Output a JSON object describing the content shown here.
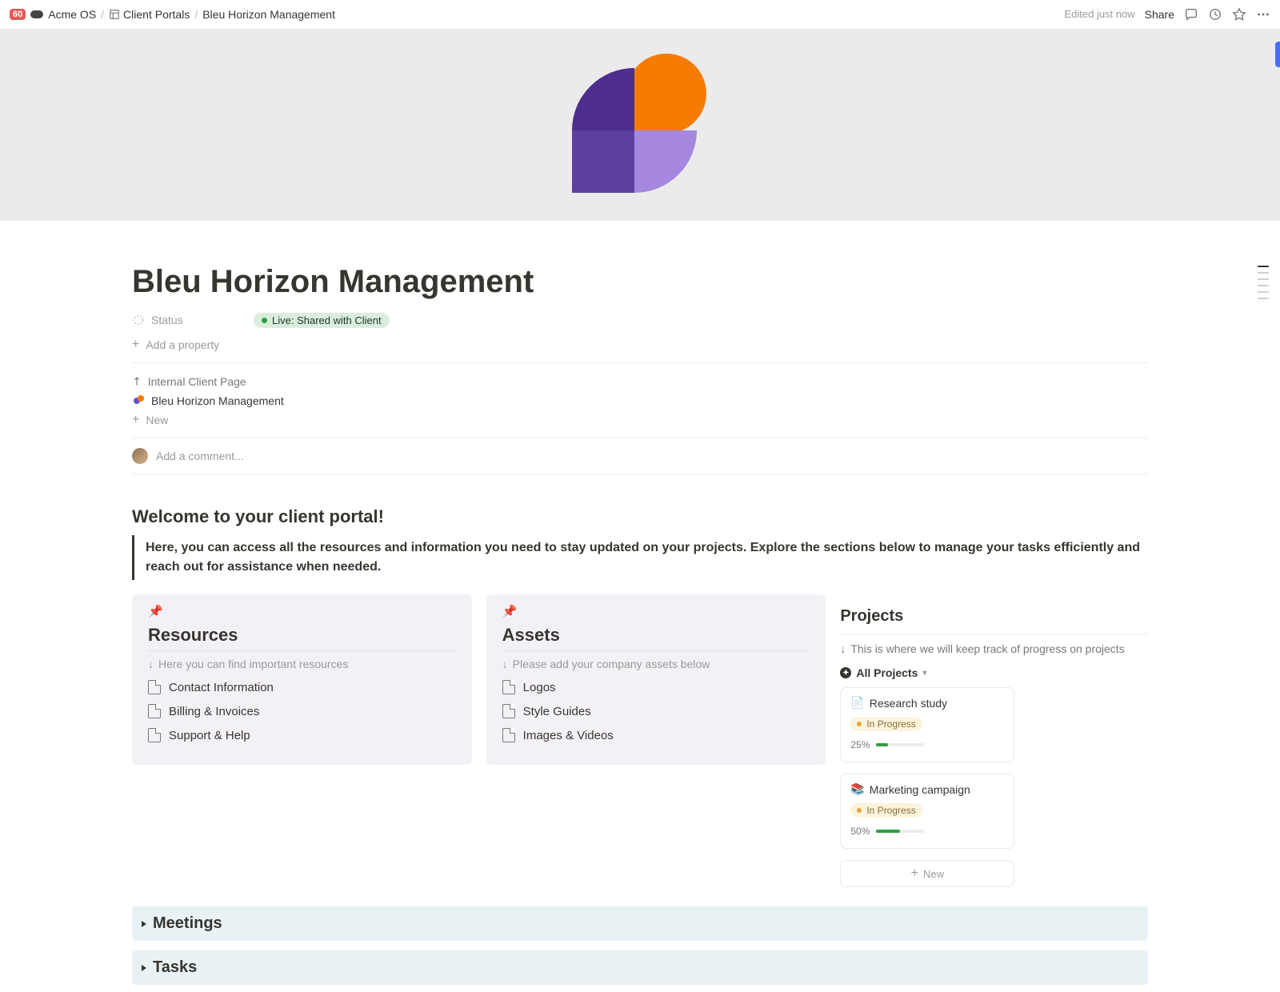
{
  "topbar": {
    "badge": "60",
    "breadcrumb": [
      "Acme OS",
      "Client Portals",
      "Bleu Horizon Management"
    ],
    "edited": "Edited just now",
    "share": "Share"
  },
  "title": "Bleu Horizon Management",
  "props": {
    "status_label": "Status",
    "status_value": "Live: Shared with Client",
    "add_property": "Add a property"
  },
  "backlinks": {
    "section_label": "Internal Client Page",
    "page": "Bleu Horizon Management",
    "new": "New"
  },
  "comment_placeholder": "Add a comment...",
  "welcome": {
    "heading": "Welcome to your client portal!",
    "body": "Here, you can access all the resources and information you need to stay updated on your projects. Explore the sections below to manage your tasks efficiently and reach out for assistance when needed."
  },
  "resources": {
    "heading": "Resources",
    "hint": "Here you can find important resources",
    "items": [
      "Contact Information",
      "Billing & Invoices",
      "Support & Help"
    ]
  },
  "assets": {
    "heading": "Assets",
    "hint": "Please add your company assets below",
    "items": [
      "Logos",
      "Style Guides",
      "Images & Videos"
    ]
  },
  "projects": {
    "heading": "Projects",
    "hint": "This is where we will keep track of progress on projects",
    "filter": "All Projects",
    "new": "New",
    "cards": [
      {
        "icon": "📄",
        "title": "Research study",
        "status": "In Progress",
        "percent": "25%",
        "progress": 25
      },
      {
        "icon": "📚",
        "title": "Marketing campaign",
        "status": "In Progress",
        "percent": "50%",
        "progress": 50
      }
    ]
  },
  "toggles": {
    "meetings": "Meetings",
    "tasks": "Tasks"
  }
}
